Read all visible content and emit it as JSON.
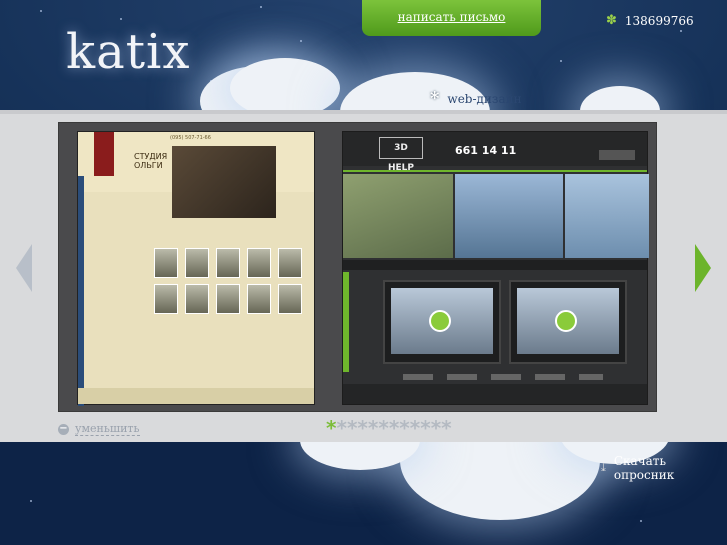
{
  "brand": {
    "logo": "katix"
  },
  "header": {
    "write_letter": "написать письмо",
    "phone": "138699766"
  },
  "portfolio": {
    "category": "web-дизайн",
    "left_site": {
      "title_line1": "СТУДИЯ",
      "title_line2": "ОЛЬГИ",
      "phone": "(095) 507-71-66"
    },
    "right_site": {
      "logo": "3D HELP",
      "phone": "661 14 11"
    }
  },
  "controls": {
    "zoom_label": "уменьшить",
    "pager_total": 12,
    "pager_active": 1,
    "download": "Скачать опросник"
  },
  "colors": {
    "accent_green": "#6fb62c",
    "background_blue": "#163259"
  }
}
